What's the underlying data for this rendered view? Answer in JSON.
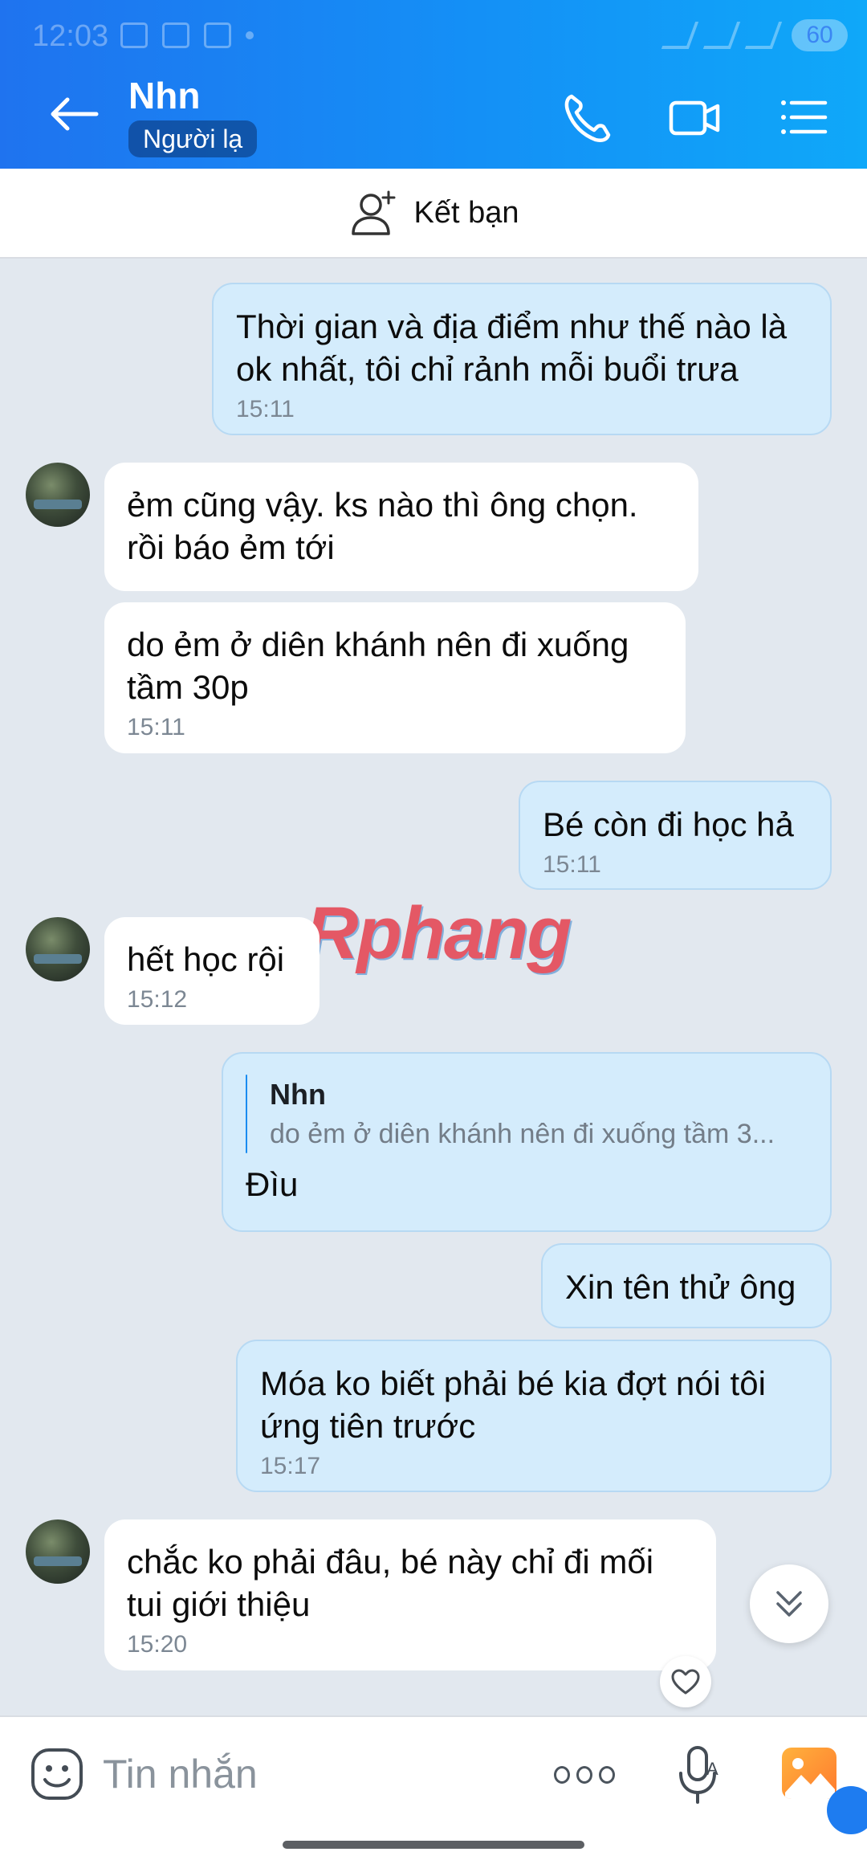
{
  "status_bar": {
    "time": "12:03",
    "battery": "60"
  },
  "header": {
    "contact_name": "Nhn",
    "badge": "Người lạ"
  },
  "friend_bar": {
    "label": "Kết bạn"
  },
  "messages": [
    {
      "direction": "outgoing",
      "text": "Thời gian và địa điểm như thế nào là ok nhất, tôi chỉ rảnh mỗi buổi trưa",
      "time": "15:11"
    },
    {
      "direction": "incoming",
      "text": "ẻm cũng vậy. ks nào thì ông chọn. rồi báo ẻm tới"
    },
    {
      "direction": "incoming",
      "text": "do ẻm ở diên khánh nên đi xuống tầm 30p",
      "time": "15:11"
    },
    {
      "direction": "outgoing",
      "text": "Bé còn đi học hả",
      "time": "15:11"
    },
    {
      "direction": "incoming",
      "text": "hết học rội",
      "time": "15:12"
    },
    {
      "direction": "outgoing",
      "quote_name": "Nhn",
      "quote_text": "do ẻm ở diên khánh nên đi xuống tầm 3...",
      "text": "Đìu"
    },
    {
      "direction": "outgoing",
      "text": "Xin tên thử ông"
    },
    {
      "direction": "outgoing",
      "text": "Móa ko biết phải bé kia đợt nói tôi ứng tiên trước",
      "time": "15:17"
    },
    {
      "direction": "incoming",
      "text": "chắc ko phải đâu, bé này chỉ đi mối tui giới thiệu",
      "time": "15:20"
    }
  ],
  "watermark": "Rphang",
  "composer": {
    "placeholder": "Tin nhắn"
  },
  "icons": {
    "back": "arrow-left-icon",
    "call": "phone-icon",
    "video": "video-camera-icon",
    "menu": "list-menu-icon",
    "add_friend": "add-user-icon",
    "heart": "heart-icon",
    "scroll_down": "chevron-double-down-icon",
    "emoji": "emoji-icon",
    "more": "more-icon",
    "mic": "mic-icon",
    "image": "image-icon"
  },
  "colors": {
    "header_start": "#1f73ef",
    "header_end": "#0fa8f9",
    "outgoing_bubble": "#d4ecfc",
    "incoming_bubble": "#ffffff",
    "chat_bg": "#e2e8ef"
  }
}
